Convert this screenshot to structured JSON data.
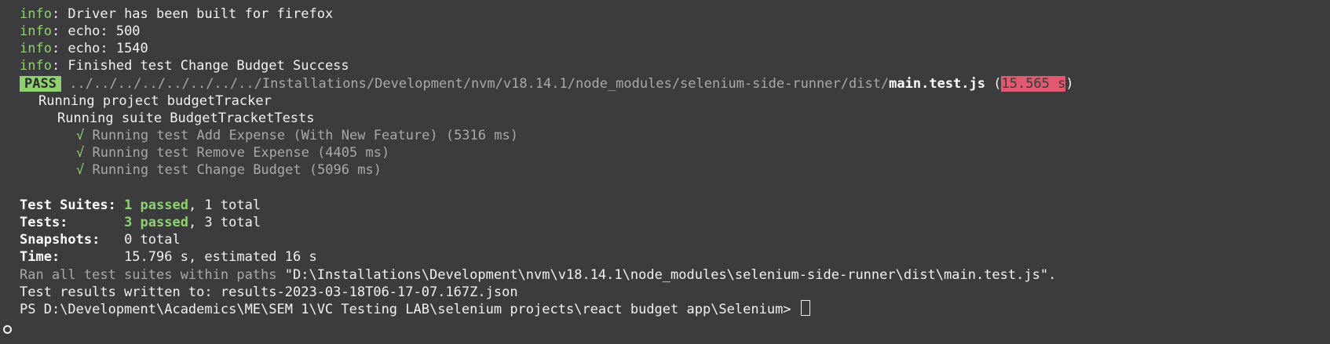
{
  "colors": {
    "background": "#3c3c3f",
    "success": "#8fd16f",
    "time_highlight": "#e0596f",
    "dim": "#a9a9a9"
  },
  "log_lines": [
    {
      "level": "info",
      "text": ": Driver has been built for firefox"
    },
    {
      "level": "info",
      "text": ": echo: 500"
    },
    {
      "level": "info",
      "text": ": echo: 1540"
    },
    {
      "level": "info",
      "text": ": Finished test Change Budget Success"
    }
  ],
  "pass_line": {
    "badge": "PASS",
    "path_dim": "../../../../../../../../Installations/Development/nvm/v18.14.1/node_modules/selenium-side-runner/dist/",
    "file": "main.test.js",
    "open_paren": " (",
    "duration": "15.565 s",
    "close_paren": ")"
  },
  "project_line": "Running project budgetTracker",
  "suite_line": "Running suite BudgetTracketTests",
  "tests": [
    {
      "check": "√",
      "text": "Running test Add Expense (With New Feature) (5316 ms)"
    },
    {
      "check": "√",
      "text": "Running test Remove Expense (4405 ms)"
    },
    {
      "check": "√",
      "text": "Running test Change Budget (5096 ms)"
    }
  ],
  "summary": {
    "suites_label": "Test Suites: ",
    "suites_passed": "1 passed",
    "suites_rest": ", 1 total",
    "tests_label": "Tests:       ",
    "tests_passed": "3 passed",
    "tests_rest": ", 3 total",
    "snapshots_label": "Snapshots:   ",
    "snapshots_value": "0 total",
    "time_label": "Time:        ",
    "time_value": "15.796 s, estimated 16 s"
  },
  "ran_all_prefix": "Ran all test suites within paths ",
  "ran_all_path": "\"D:\\Installations\\Development\\nvm\\v18.14.1\\node_modules\\selenium-side-runner\\dist\\main.test.js\".",
  "results_line": "Test results written to: results-2023-03-18T06-17-07.167Z.json",
  "prompt": "PS D:\\Development\\Academics\\ME\\SEM 1\\VC Testing LAB\\selenium projects\\react budget app\\Selenium> "
}
